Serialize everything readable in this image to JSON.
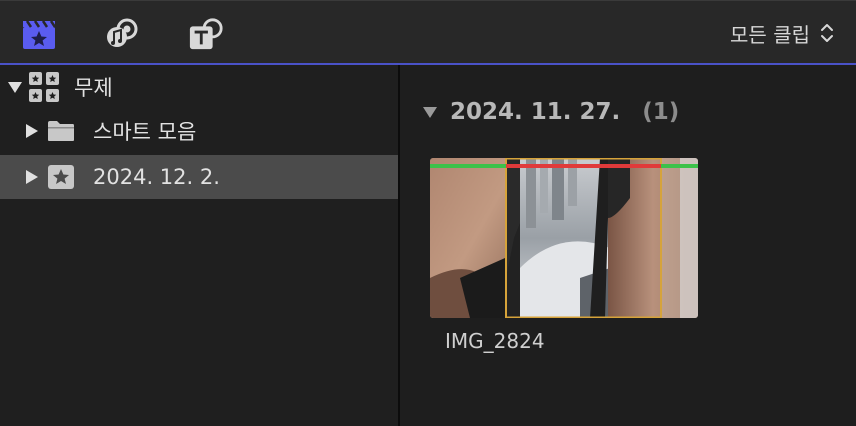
{
  "toolbar": {
    "icons": [
      "media-library-icon",
      "photos-music-icon",
      "titles-generators-icon"
    ],
    "clip_filter_label": "모든 클립",
    "accent_color": "#4a52c8"
  },
  "sidebar": {
    "library": {
      "name": "무제",
      "expanded": true
    },
    "items": [
      {
        "label": "스마트 모음",
        "icon": "folder-icon",
        "selected": false
      },
      {
        "label": "2024. 12. 2.",
        "icon": "event-star-icon",
        "selected": true
      }
    ]
  },
  "browser": {
    "group": {
      "date": "2024. 11. 27.",
      "count": "(1)"
    },
    "clips": [
      {
        "name": "IMG_2824",
        "rating_colors": [
          "#3cc24a",
          "#e03a3a",
          "#3cc24a"
        ],
        "selection_color": "#d6a33a"
      }
    ]
  }
}
